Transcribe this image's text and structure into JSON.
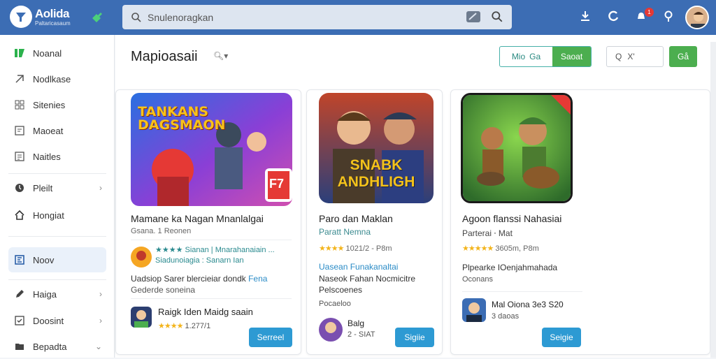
{
  "header": {
    "brand_name": "Aolida",
    "brand_tagline": "Paltaricasaum",
    "search_placeholder": "Snulenoragkan",
    "notification_count": "1"
  },
  "sidebar": {
    "items": [
      {
        "label": "Noanal",
        "icon": "home-icon"
      },
      {
        "label": "Nodlkase",
        "icon": "heart-icon"
      },
      {
        "label": "Sitenies",
        "icon": "grid-icon"
      },
      {
        "label": "Maoeat",
        "icon": "bookmark-icon"
      },
      {
        "label": "Naitles",
        "icon": "list-icon"
      },
      {
        "label": "Pleilt",
        "icon": "circle-icon"
      },
      {
        "label": "Hongiat",
        "icon": "upload-icon"
      },
      {
        "label": "Noov",
        "icon": "news-icon"
      },
      {
        "label": "Haiga",
        "icon": "pencil-icon"
      },
      {
        "label": "Doosint",
        "icon": "check-icon"
      },
      {
        "label": "Bepadta",
        "icon": "folder-icon"
      }
    ]
  },
  "main": {
    "title": "Mapioasaii",
    "toggle": {
      "option_a": "Mio",
      "option_a2": "Ga",
      "option_b": "Saoat"
    },
    "filter_placeholder": "Q",
    "filter_x": "X'",
    "go_label": "Gå"
  },
  "cards": [
    {
      "art_title_line1": "TANKANS",
      "art_title_line2": "DAGSMAON",
      "art_badge": "F7",
      "title": "Mamane ka Nagan Mnanlalgai",
      "subtitle": "Gsana. 1 Reonen",
      "rating_text": "★★★★ Sianan | Mnarahanaiain ...",
      "rating_sub": "Siadunoiagia : Sanarn Ian",
      "desc1_a": "Uadsiop Sarer blercieiar dondk ",
      "desc1_b": "Fena",
      "desc2": "Gederde soneina",
      "author": "Raigk Iden Maidg saain",
      "author_meta": "1.277/1",
      "button": "Serreel"
    },
    {
      "art_title_line1": "SNABK",
      "art_title_line2": "ANDHLIGH",
      "title": "Paro dan Maklan",
      "subtitle": "Paratt Nemna",
      "rating_text": "1021/2 - P8m",
      "desc1": "Uasean Funakanaltai",
      "desc2": "Naseok Fahan Nocmicitre",
      "desc3": "Pelscoenes",
      "desc4": "Pocaeloo",
      "author": "Balg",
      "author_meta": "2 - SIAT",
      "button": "Sigiie"
    },
    {
      "art_badge": "",
      "title": "Agoon flanssi Nahasiai",
      "subtitle": "Parterai ⸱ Mat",
      "rating_text": "3605m, P8m",
      "desc1": "Plpearke IOenjahmahada",
      "desc2": "Oconans",
      "author": "Mal Oiona 3e3 S20",
      "author_meta": "3 daoas",
      "button": "Seigie"
    }
  ]
}
